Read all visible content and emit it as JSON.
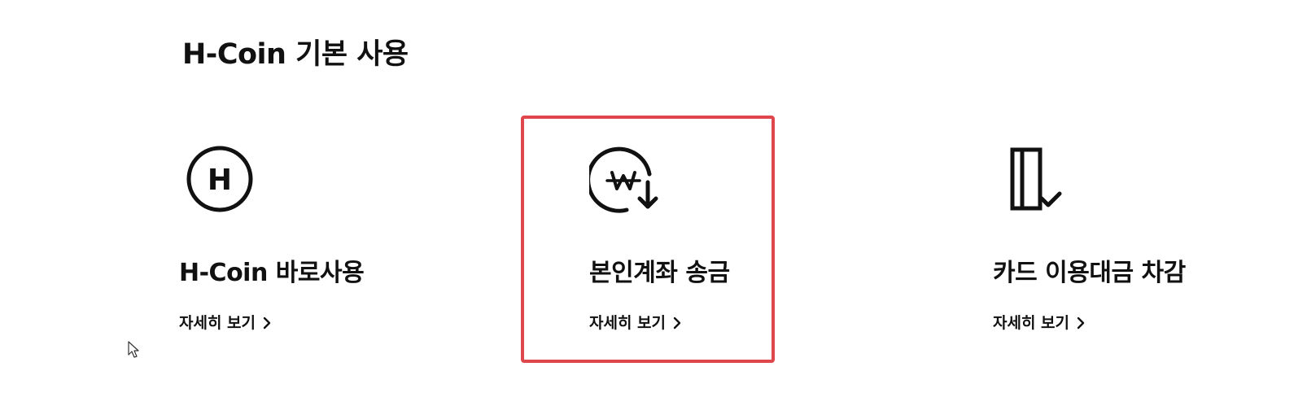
{
  "section": {
    "title": "H-Coin 기본 사용"
  },
  "cards": [
    {
      "title": "H-Coin 바로사용",
      "link": "자세히 보기",
      "icon": "h-coin-circle-icon",
      "icon_letter": "H"
    },
    {
      "title": "본인계좌 송금",
      "link": "자세히 보기",
      "icon": "won-transfer-icon",
      "highlighted": true
    },
    {
      "title": "카드 이용대금 차감",
      "link": "자세히 보기",
      "icon": "card-payment-check-icon"
    }
  ],
  "colors": {
    "highlight_border": "#e0474c",
    "text": "#111111",
    "background": "#ffffff"
  }
}
